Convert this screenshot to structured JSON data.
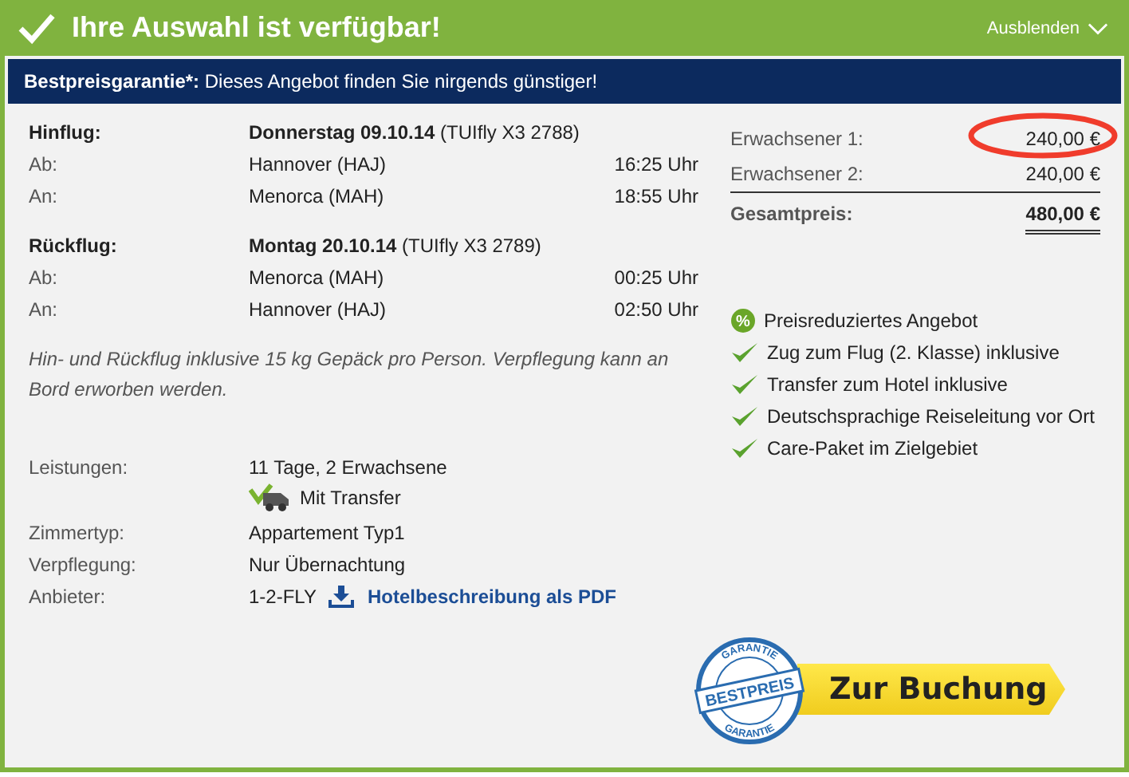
{
  "header": {
    "title": "Ihre Auswahl ist verfügbar!",
    "toggle": "Ausblenden"
  },
  "banner": {
    "text": "**Bestpreisgarantie*:** Dieses Angebot finden Sie nirgends günstiger!"
  },
  "flights": [
    {
      "label": "Hinflug:",
      "date": "Donnerstag 09.10.14",
      "flight": "(TUIfly X3 2788)",
      "legs": [
        {
          "label": "Ab:",
          "place": "Hannover (HAJ)",
          "time": "16:25 Uhr"
        },
        {
          "label": "An:",
          "place": "Menorca (MAH)",
          "time": "18:55 Uhr"
        }
      ]
    },
    {
      "label": "Rückflug:",
      "date": "Montag 20.10.14",
      "flight": "(TUIfly X3 2789)",
      "legs": [
        {
          "label": "Ab:",
          "place": "Menorca (MAH)",
          "time": "00:25 Uhr"
        },
        {
          "label": "An:",
          "place": "Hannover (HAJ)",
          "time": "02:50 Uhr"
        }
      ]
    }
  ],
  "note": "Hin- und Rückflug inklusive 15 kg Gepäck pro Person. Verpflegung kann an Bord erworben werden.",
  "details": [
    {
      "label": "Leistungen:",
      "value": "11 Tage, 2 Erwachsene",
      "extra": "Mit Transfer"
    },
    {
      "label": "Zimmertyp:",
      "value": "Appartement Typ1"
    },
    {
      "label": "Verpflegung:",
      "value": "Nur Übernachtung"
    },
    {
      "label": "Anbieter:",
      "value": "1-2-FLY",
      "link": "Hotelbeschreibung als PDF"
    }
  ],
  "prices": [
    {
      "label": "Erwachsener 1:",
      "amount": "240,00 €",
      "highlighted": true
    },
    {
      "label": "Erwachsener 2:",
      "amount": "240,00 €",
      "highlighted": false
    }
  ],
  "total": {
    "label": "Gesamtpreis:",
    "amount": "480,00 €"
  },
  "features": [
    {
      "kind": "percent",
      "badge": "%",
      "text": "Preisreduziertes Angebot"
    },
    {
      "kind": "check",
      "text": "Zug zum Flug (2. Klasse) inklusive"
    },
    {
      "kind": "check",
      "text": "Transfer zum Hotel inklusive"
    },
    {
      "kind": "check",
      "text": "Deutschsprachige Reiseleitung vor Ort"
    },
    {
      "kind": "check",
      "text": "Care-Paket im Zielgebiet"
    }
  ],
  "stamp": {
    "top": "GARANTIE",
    "middle": "BESTPREIS",
    "bottom": "GARANTIE"
  },
  "book_button": "Zur Buchung"
}
